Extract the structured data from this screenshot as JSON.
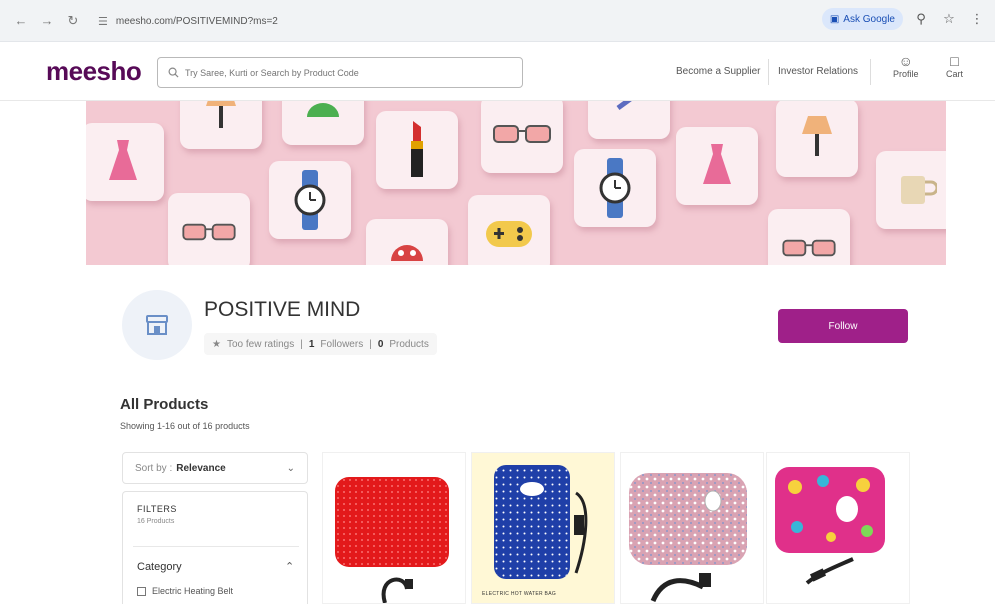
{
  "browser": {
    "url": "meesho.com/POSITIVEMIND?ms=2",
    "ask_google": "Ask Google"
  },
  "header": {
    "logo": "meesho",
    "search_placeholder": "Try Saree, Kurti or Search by Product Code",
    "become_supplier": "Become a Supplier",
    "investor_relations": "Investor Relations",
    "profile_label": "Profile",
    "cart_label": "Cart"
  },
  "shop": {
    "name": "POSITIVE MIND",
    "rating_text": "Too few ratings",
    "followers_count": "1",
    "followers_label": "Followers",
    "products_count": "0",
    "products_label": "Products",
    "follow_label": "Follow"
  },
  "products_section": {
    "title": "All Products",
    "showing_text": "Showing 1-16 out of 16 products",
    "sort_prefix": "Sort by :",
    "sort_value": "Relevance",
    "filters_title": "FILTERS",
    "filters_sub": "16 Products",
    "category_label": "Category",
    "category_option": "Electric Heating Belt",
    "card_caption": "ELECTRIC HOT WATER BAG"
  },
  "colors": {
    "brand": "#570a57",
    "follow_button": "#9f2089",
    "banner": "#f3c9d2"
  },
  "icons": {
    "back": "arrow-left-icon",
    "forward": "arrow-right-icon",
    "reload": "reload-icon",
    "search": "search-icon",
    "bookmark": "star-icon",
    "profile": "user-icon",
    "cart": "cart-icon"
  }
}
